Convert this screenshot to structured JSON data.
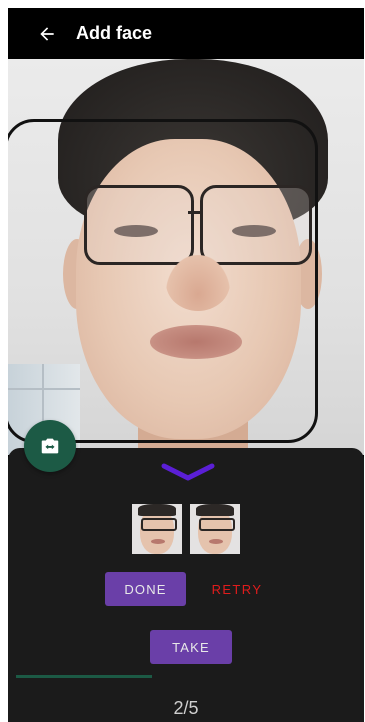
{
  "appbar": {
    "title": "Add face",
    "back_icon": "arrow-back-icon"
  },
  "preview": {
    "switch_camera_icon": "switch-camera-icon"
  },
  "sheet": {
    "collapse_icon": "chevron-down-icon",
    "thumbnails": [
      {
        "name": "captured-face-1"
      },
      {
        "name": "captured-face-2"
      }
    ],
    "done_label": "DONE",
    "retry_label": "RETRY",
    "take_label": "TAKE",
    "progress": 0.4,
    "counter": "2/5"
  },
  "colors": {
    "accent_purple": "#6a3fa8",
    "retry_red": "#e01c1c",
    "fab_green": "#1c5a45",
    "sheet_bg": "#1b1b1b"
  }
}
